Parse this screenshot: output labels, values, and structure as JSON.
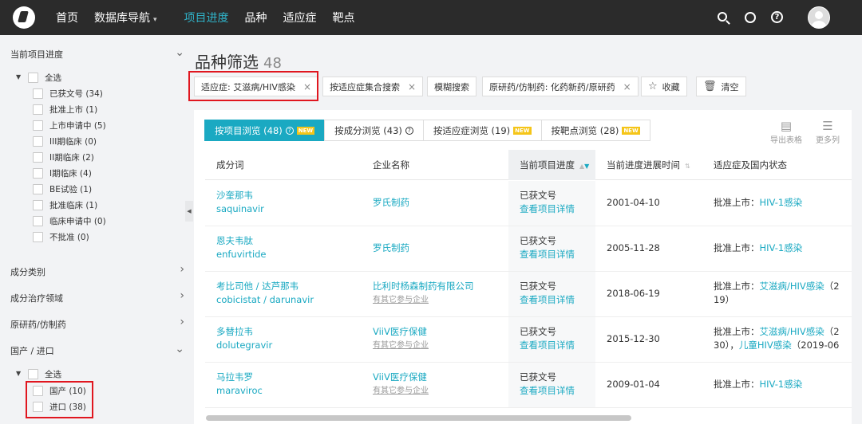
{
  "nav": {
    "items": [
      {
        "label": "首页",
        "active": false
      },
      {
        "label": "数据库导航",
        "active": false,
        "dropdown": true
      },
      {
        "label": "项目进度",
        "active": true
      },
      {
        "label": "品种",
        "active": false
      },
      {
        "label": "适应症",
        "active": false
      },
      {
        "label": "靶点",
        "active": false
      }
    ]
  },
  "sidebar": {
    "progress": {
      "title": "当前项目进度",
      "all_label": "全选",
      "options": [
        "已获文号 (34)",
        "批准上市 (1)",
        "上市申请中 (5)",
        "III期临床 (0)",
        "II期临床 (2)",
        "I期临床 (4)",
        "BE试验 (1)",
        "批准临床 (1)",
        "临床申请中 (0)",
        "不批准 (0)"
      ]
    },
    "sections": [
      {
        "title": "成分类别"
      },
      {
        "title": "成分治疗领域"
      },
      {
        "title": "原研药/仿制药"
      }
    ],
    "origin": {
      "title": "国产 / 进口",
      "all_label": "全选",
      "options": [
        "国产 (10)",
        "进口 (38)"
      ]
    }
  },
  "main": {
    "title": "品种筛选",
    "count": "48",
    "chips": [
      {
        "label": "适应症: 艾滋病/HIV感染",
        "close": "×"
      },
      {
        "label": "按适应症集合搜索",
        "close": "×"
      },
      {
        "label": "模糊搜索"
      },
      {
        "label": "原研药/仿制药: 化药新药/原研药",
        "close": "×"
      },
      {
        "label": "收藏"
      },
      {
        "label": "清空"
      }
    ]
  },
  "tabs": [
    {
      "label": "按项目浏览 (48)",
      "badge": "NEW"
    },
    {
      "label": "按成分浏览 (43)"
    },
    {
      "label": "按适应症浏览 (19)",
      "badge": "NEW"
    },
    {
      "label": "按靶点浏览 (28)",
      "badge": "NEW"
    }
  ],
  "tools": {
    "export": "导出表格",
    "more": "更多列"
  },
  "table": {
    "columns": [
      "成分词",
      "企业名称",
      "当前项目进度",
      "当前进度进展时间",
      "适应症及国内状态"
    ],
    "rows": [
      {
        "name_cn": "沙奎那韦",
        "name_en": "saquinavir",
        "company": "罗氏制药",
        "company_sub": "",
        "status": "已获文号",
        "detail": "查看项目详情",
        "date": "2001-04-10",
        "ind_prefix": "批准上市：",
        "ind_link": "HIV-1感染",
        "ind_rest": "",
        "ind_line2": "",
        "ind_line2_link": "",
        "ind_line2_rest": ""
      },
      {
        "name_cn": "恩夫韦肽",
        "name_en": "enfuvirtide",
        "company": "罗氏制药",
        "company_sub": "",
        "status": "已获文号",
        "detail": "查看项目详情",
        "date": "2005-11-28",
        "ind_prefix": "批准上市：",
        "ind_link": "HIV-1感染",
        "ind_rest": "",
        "ind_line2": "",
        "ind_line2_link": "",
        "ind_line2_rest": ""
      },
      {
        "name_cn": "考比司他 / 达芦那韦",
        "name_en": "cobicistat / darunavir",
        "company": "比利时杨森制药有限公司",
        "company_sub": "有其它参与企业",
        "status": "已获文号",
        "detail": "查看项目详情",
        "date": "2018-06-19",
        "ind_prefix": "批准上市：",
        "ind_link": "艾滋病/HIV感染",
        "ind_rest": "（2",
        "ind_line2": "19）",
        "ind_line2_link": "",
        "ind_line2_rest": ""
      },
      {
        "name_cn": "多替拉韦",
        "name_en": "dolutegravir",
        "company": "ViiV医疗保健",
        "company_sub": "有其它参与企业",
        "status": "已获文号",
        "detail": "查看项目详情",
        "date": "2015-12-30",
        "ind_prefix": "批准上市：",
        "ind_link": "艾滋病/HIV感染",
        "ind_rest": "（2",
        "ind_line2": "30），",
        "ind_line2_link": "儿童HIV感染",
        "ind_line2_rest": "（2019-06"
      },
      {
        "name_cn": "马拉韦罗",
        "name_en": "maraviroc",
        "company": "ViiV医疗保健",
        "company_sub": "有其它参与企业",
        "status": "已获文号",
        "detail": "查看项目详情",
        "date": "2009-01-04",
        "ind_prefix": "批准上市：",
        "ind_link": "HIV-1感染",
        "ind_rest": "",
        "ind_line2": "",
        "ind_line2_link": "",
        "ind_line2_rest": ""
      }
    ]
  }
}
